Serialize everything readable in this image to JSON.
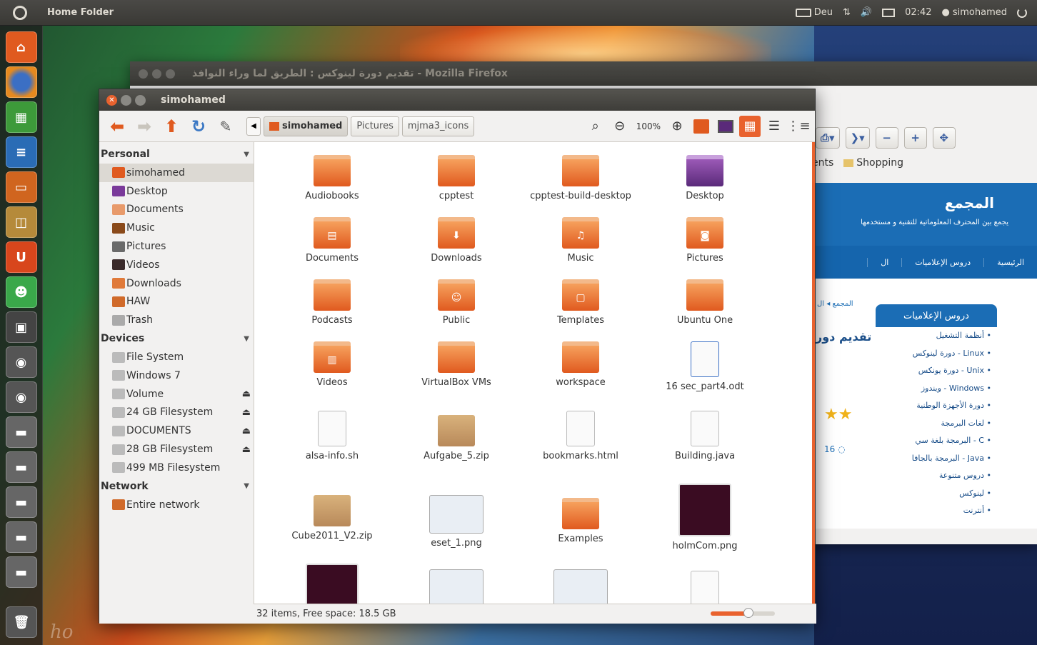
{
  "top_panel": {
    "title": "Home Folder",
    "keyboard": "Deu",
    "time": "02:42",
    "user": "simohamed"
  },
  "launcher": {
    "items": [
      "home-folder",
      "firefox",
      "libreoffice-calc",
      "libreoffice-writer",
      "libreoffice-impress",
      "software-center",
      "ubuntu-one",
      "empathy",
      "workspace-switcher",
      "disk-1",
      "disk-2",
      "drive-1",
      "drive-2",
      "drive-3",
      "drive-4",
      "drive-5"
    ],
    "trash": "trash"
  },
  "firefox": {
    "title": "تقديم دورة لينوكس : الطريق لما وراء النوافذ - Mozilla Firefox",
    "bookmarks": [
      "ents",
      "Shopping"
    ],
    "site_name": "المجمع",
    "site_tagline": "يجمع بين المحترف المعلوماتية للتقنية و مستخدمها",
    "nav": [
      "الرئيسية",
      "دروس الإعلاميات",
      "ال"
    ],
    "crumb": "المجمع ◂ ال",
    "post_title": "تقديم دور",
    "comments": "16",
    "side_title": "دروس الإعلاميات",
    "side_items": [
      "أنظمة التشغيل",
      "دورة لينوكس - Linux",
      "دورة يونكس - Unix",
      "ويندوز - Windows",
      "دورة الأجهزة الوطنية",
      "لغات البرمجة",
      "البرمجة بلغة سي - C",
      "البرمجة بالجافا - Java",
      "دروس متنوعة",
      "لينوكس",
      "أنترنت"
    ]
  },
  "nautilus": {
    "title": "simohamed",
    "path": [
      "simohamed",
      "Pictures",
      "mjma3_icons"
    ],
    "zoom": "100%",
    "sidebar": {
      "personal_header": "Personal",
      "personal": [
        "simohamed",
        "Desktop",
        "Documents",
        "Music",
        "Pictures",
        "Videos",
        "Downloads",
        "HAW",
        "Trash"
      ],
      "devices_header": "Devices",
      "devices": [
        "File System",
        "Windows 7",
        "Volume",
        "24 GB Filesystem",
        "DOCUMENTS",
        "28 GB Filesystem",
        "499 MB Filesystem"
      ],
      "network_header": "Network",
      "network": [
        "Entire network"
      ]
    },
    "files": [
      {
        "name": "Audiobooks",
        "kind": "folder"
      },
      {
        "name": "cpptest",
        "kind": "folder"
      },
      {
        "name": "cpptest-build-desktop",
        "kind": "folder"
      },
      {
        "name": "Desktop",
        "kind": "desktop"
      },
      {
        "name": "Documents",
        "kind": "folder"
      },
      {
        "name": "Downloads",
        "kind": "folder"
      },
      {
        "name": "Music",
        "kind": "folder"
      },
      {
        "name": "Pictures",
        "kind": "folder"
      },
      {
        "name": "Podcasts",
        "kind": "folder"
      },
      {
        "name": "Public",
        "kind": "folder"
      },
      {
        "name": "Templates",
        "kind": "folder"
      },
      {
        "name": "Ubuntu One",
        "kind": "folder"
      },
      {
        "name": "Videos",
        "kind": "folder"
      },
      {
        "name": "VirtualBox VMs",
        "kind": "folder"
      },
      {
        "name": "workspace",
        "kind": "folder"
      },
      {
        "name": "16 sec_part4.odt",
        "kind": "doc"
      },
      {
        "name": "alsa-info.sh",
        "kind": "doc"
      },
      {
        "name": "Aufgabe_5.zip",
        "kind": "zip"
      },
      {
        "name": "bookmarks.html",
        "kind": "doc"
      },
      {
        "name": "Building.java",
        "kind": "doc"
      },
      {
        "name": "Cube2011_V2.zip",
        "kind": "zip"
      },
      {
        "name": "eset_1.png",
        "kind": "shot"
      },
      {
        "name": "Examples",
        "kind": "folder"
      },
      {
        "name": "holmCom.png",
        "kind": "thumb"
      },
      {
        "name": "",
        "kind": "thumb"
      },
      {
        "name": "",
        "kind": "shot"
      },
      {
        "name": "",
        "kind": "shot"
      },
      {
        "name": "",
        "kind": "doc"
      }
    ],
    "status": "32 items, Free space: 18.5 GB"
  },
  "colors": {
    "accent": "#e9622e",
    "panel": "#3c3b37",
    "site_blue": "#1b6db5"
  }
}
